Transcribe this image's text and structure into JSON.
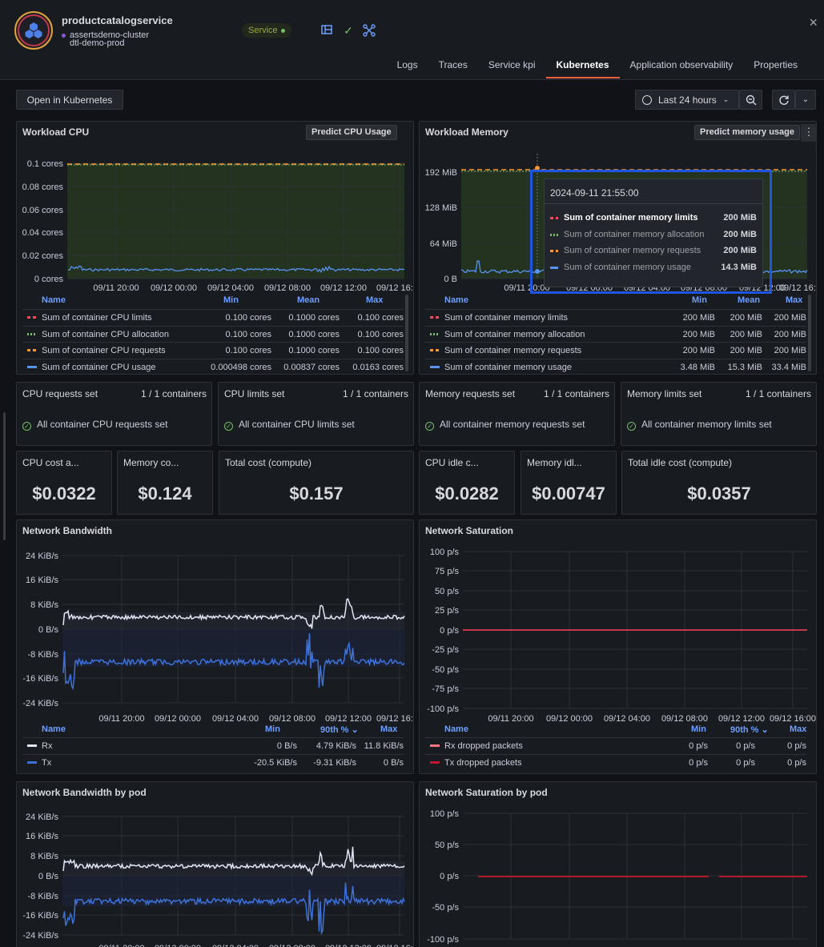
{
  "header": {
    "service_name": "productcatalogservice",
    "cluster": "assertsdemo-cluster",
    "env": "dtl-demo-prod",
    "badge": "Service",
    "icons": [
      "dashboard-icon",
      "check-icon",
      "graph-icon"
    ],
    "close": "×"
  },
  "tabs": [
    "Logs",
    "Traces",
    "Service kpi",
    "Kubernetes",
    "Application observability",
    "Properties"
  ],
  "active_tab": "Kubernetes",
  "toolbar": {
    "open_k8s": "Open in Kubernetes",
    "time_range": "Last 24 hours"
  },
  "x_ticks": [
    "09/11 20:00",
    "09/12 00:00",
    "09/12 04:00",
    "09/12 08:00",
    "09/12 12:00",
    "09/12 16:00"
  ],
  "cpu": {
    "title": "Workload CPU",
    "predict": "Predict CPU Usage",
    "y_ticks": [
      "0.1 cores",
      "0.08 cores",
      "0.06 cores",
      "0.04 cores",
      "0.02 cores",
      "0 cores"
    ],
    "legend_head": {
      "name": "Name",
      "min": "Min",
      "mean": "Mean",
      "max": "Max"
    },
    "legend": [
      {
        "name": "Sum of container CPU limits",
        "min": "0.100 cores",
        "mean": "0.1000 cores",
        "max": "0.100 cores",
        "color": "#f2495c",
        "style": "dash"
      },
      {
        "name": "Sum of container CPU allocation",
        "min": "0.100 cores",
        "mean": "0.1000 cores",
        "max": "0.100 cores",
        "color": "#73bf69",
        "style": "dot"
      },
      {
        "name": "Sum of container CPU requests",
        "min": "0.100 cores",
        "mean": "0.1000 cores",
        "max": "0.100 cores",
        "color": "#ff9830",
        "style": "dash"
      },
      {
        "name": "Sum of container CPU usage",
        "min": "0.000498 cores",
        "mean": "0.00837 cores",
        "max": "0.0163 cores",
        "color": "#5794f2",
        "style": "solid"
      }
    ]
  },
  "memory": {
    "title": "Workload Memory",
    "predict": "Predict memory usage",
    "y_ticks": [
      "192 MiB",
      "128 MiB",
      "64 MiB",
      "0 B"
    ],
    "legend_head": {
      "name": "Name",
      "min": "Min",
      "mean": "Mean",
      "max": "Max"
    },
    "legend": [
      {
        "name": "Sum of container memory limits",
        "min": "200 MiB",
        "mean": "200 MiB",
        "max": "200 MiB",
        "color": "#f2495c",
        "style": "dash"
      },
      {
        "name": "Sum of container memory allocation",
        "min": "200 MiB",
        "mean": "200 MiB",
        "max": "200 MiB",
        "color": "#73bf69",
        "style": "dot"
      },
      {
        "name": "Sum of container memory requests",
        "min": "200 MiB",
        "mean": "200 MiB",
        "max": "200 MiB",
        "color": "#ff9830",
        "style": "dash"
      },
      {
        "name": "Sum of container memory usage",
        "min": "3.48 MiB",
        "mean": "15.3 MiB",
        "max": "33.4 MiB",
        "color": "#5794f2",
        "style": "solid"
      }
    ],
    "tooltip": {
      "time": "2024-09-11 21:55:00",
      "rows": [
        {
          "name": "Sum of container memory limits",
          "value": "200 MiB",
          "color": "#f2495c"
        },
        {
          "name": "Sum of container memory allocation",
          "value": "200 MiB",
          "color": "#73bf69"
        },
        {
          "name": "Sum of container memory requests",
          "value": "200 MiB",
          "color": "#ff9830"
        },
        {
          "name": "Sum of container memory usage",
          "value": "14.3 MiB",
          "color": "#5794f2"
        }
      ]
    }
  },
  "checks": [
    {
      "title": "CPU requests set",
      "count": "1 / 1 containers",
      "msg": "All container CPU requests set"
    },
    {
      "title": "CPU limits set",
      "count": "1 / 1 containers",
      "msg": "All container CPU limits set"
    },
    {
      "title": "Memory requests set",
      "count": "1 / 1 containers",
      "msg": "All container memory requests set"
    },
    {
      "title": "Memory limits set",
      "count": "1 / 1 containers",
      "msg": "All container memory limits set"
    }
  ],
  "costs": [
    {
      "title": "CPU cost a...",
      "value": "$0.0322"
    },
    {
      "title": "Memory co...",
      "value": "$0.124"
    },
    {
      "title": "Total cost (compute)",
      "value": "$0.157"
    },
    {
      "title": "CPU idle c...",
      "value": "$0.0282"
    },
    {
      "title": "Memory idl...",
      "value": "$0.00747"
    },
    {
      "title": "Total idle cost (compute)",
      "value": "$0.0357"
    }
  ],
  "net_bw": {
    "title": "Network Bandwidth",
    "y_ticks": [
      "24 KiB/s",
      "16 KiB/s",
      "8 KiB/s",
      "0 B/s",
      "-8 KiB/s",
      "-16 KiB/s",
      "-24 KiB/s"
    ],
    "legend_head": {
      "name": "Name",
      "min": "Min",
      "p90": "90th %",
      "max": "Max"
    },
    "legend": [
      {
        "name": "Rx",
        "min": "0 B/s",
        "p90": "4.79 KiB/s",
        "max": "11.8 KiB/s",
        "color": "#e0e6f5"
      },
      {
        "name": "Tx",
        "min": "-20.5 KiB/s",
        "p90": "-9.31 KiB/s",
        "max": "0 B/s",
        "color": "#3d71d9"
      }
    ]
  },
  "net_sat": {
    "title": "Network Saturation",
    "y_ticks": [
      "100 p/s",
      "75 p/s",
      "50 p/s",
      "25 p/s",
      "0 p/s",
      "-25 p/s",
      "-50 p/s",
      "-75 p/s",
      "-100 p/s"
    ],
    "legend_head": {
      "name": "Name",
      "min": "Min",
      "p90": "90th %",
      "max": "Max"
    },
    "legend": [
      {
        "name": "Rx dropped packets",
        "min": "0 p/s",
        "p90": "0 p/s",
        "max": "0 p/s",
        "color": "#ff7383"
      },
      {
        "name": "Tx dropped packets",
        "min": "0 p/s",
        "p90": "0 p/s",
        "max": "0 p/s",
        "color": "#c4162a"
      }
    ]
  },
  "net_bw_pod": {
    "title": "Network Bandwidth by pod",
    "y_ticks": [
      "24 KiB/s",
      "16 KiB/s",
      "8 KiB/s",
      "0 B/s",
      "-8 KiB/s",
      "-16 KiB/s",
      "-24 KiB/s"
    ]
  },
  "net_sat_pod": {
    "title": "Network Saturation by pod",
    "y_ticks": [
      "100 p/s",
      "50 p/s",
      "0 p/s",
      "-50 p/s",
      "-100 p/s"
    ]
  }
}
